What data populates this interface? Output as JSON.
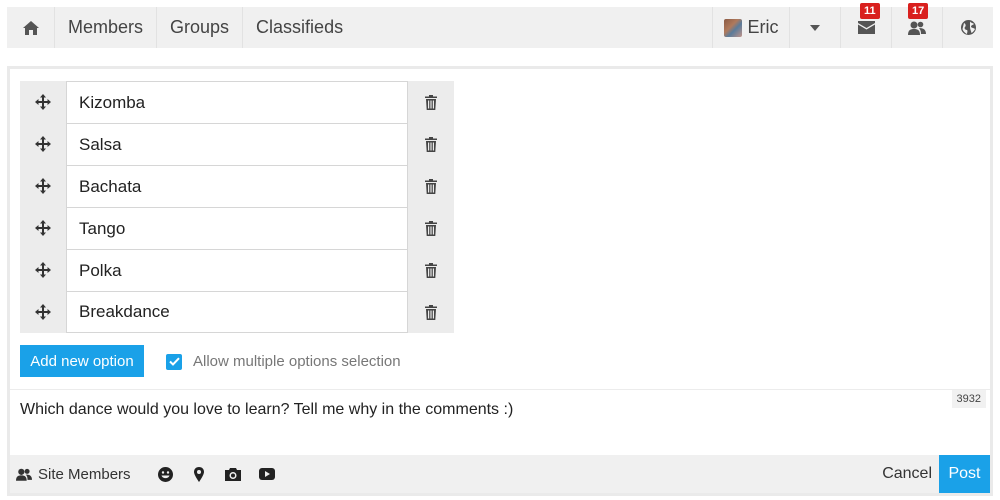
{
  "nav": {
    "home_icon": "home-icon",
    "links": [
      "Members",
      "Groups",
      "Classifieds"
    ],
    "user_name": "Eric",
    "messages_badge": "11",
    "friends_badge": "17",
    "icons": [
      "chevron-down-icon",
      "envelope-icon",
      "users-icon",
      "globe-icon"
    ]
  },
  "poll": {
    "options": [
      "Kizomba",
      "Salsa",
      "Bachata",
      "Tango",
      "Polka",
      "Breakdance"
    ],
    "add_option_label": "Add new option",
    "allow_multiple_label": "Allow multiple options selection",
    "allow_multiple_checked": true
  },
  "composer": {
    "text": "Which dance would you love to learn? Tell me why in the comments :)",
    "char_counter": "3932",
    "privacy_label": "Site Members",
    "tools": [
      "emoji-icon",
      "location-pin-icon",
      "camera-icon",
      "video-icon"
    ],
    "cancel_label": "Cancel",
    "post_label": "Post"
  },
  "colors": {
    "accent": "#1aa1e8",
    "badge": "#d9201e",
    "bar_bg": "#f0f0f0"
  }
}
